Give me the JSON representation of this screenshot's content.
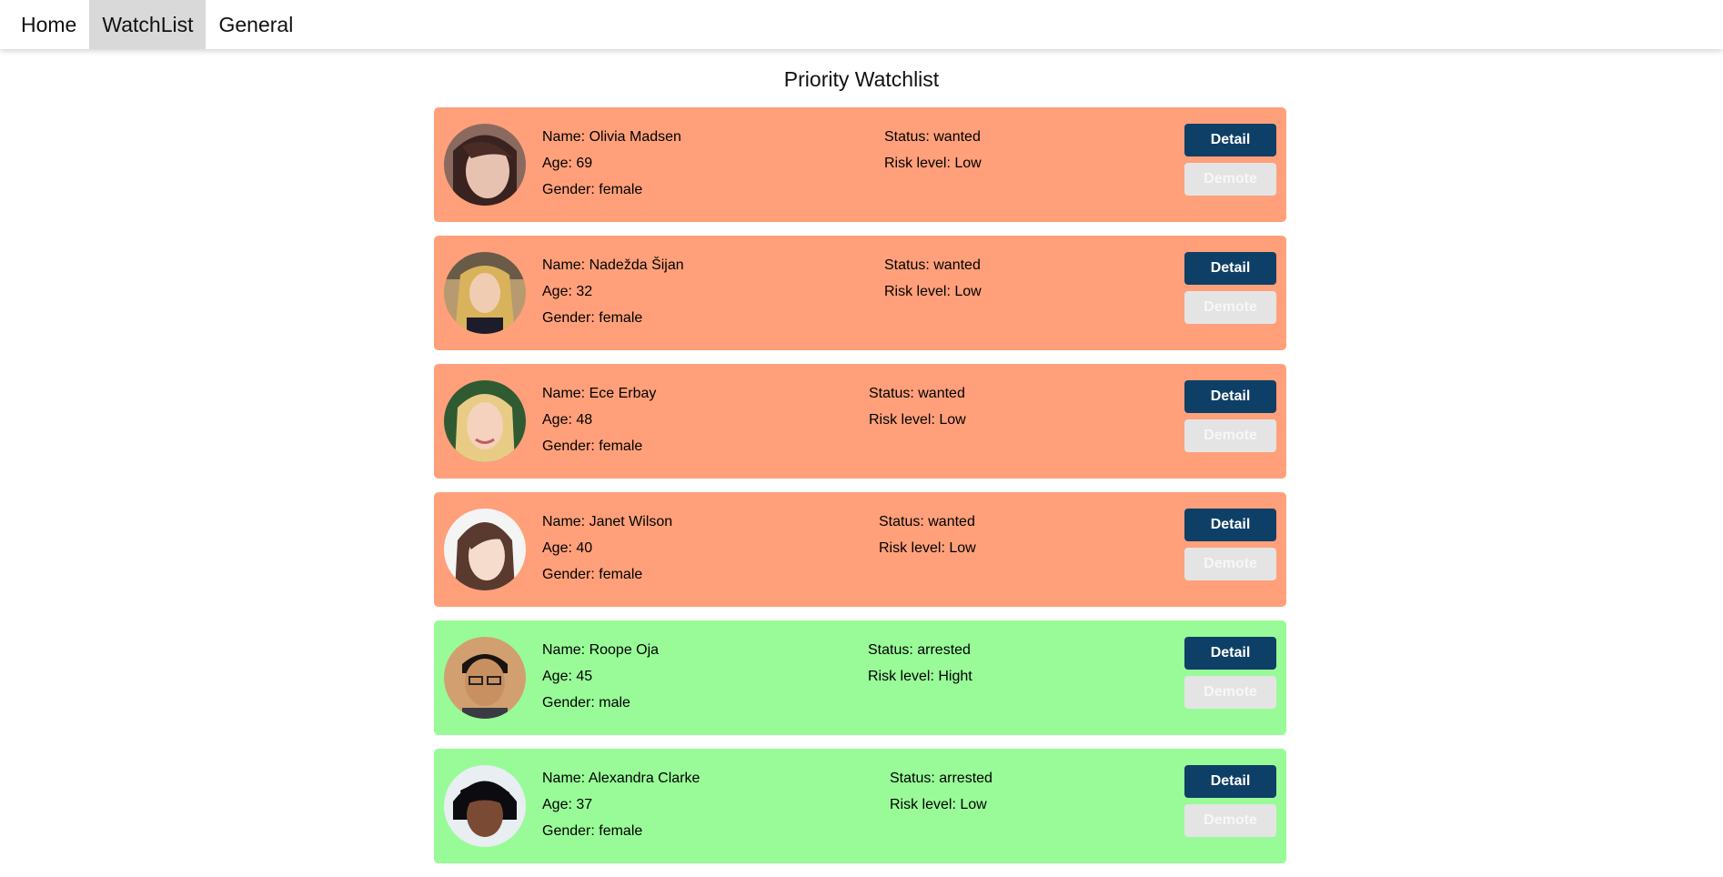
{
  "nav": {
    "items": [
      "Home",
      "WatchList",
      "General"
    ],
    "active": "WatchList"
  },
  "page": {
    "title": "Priority Watchlist"
  },
  "colors": {
    "wanted": "#ffa07a",
    "arrested": "#98fb98",
    "detail_button": "#0e3f66",
    "active_nav": "#d9d9d9"
  },
  "buttons": {
    "detail": "Detail",
    "demote": "Demote"
  },
  "cards": [
    {
      "name": "Name: Olivia Madsen",
      "age": "Age: 69",
      "gender": "Gender: female",
      "status": "Status: wanted",
      "risk": "Risk level: Low",
      "state": "wanted"
    },
    {
      "name": "Name: Nadežda Šijan",
      "age": "Age: 32",
      "gender": "Gender: female",
      "status": "Status: wanted",
      "risk": "Risk level: Low",
      "state": "wanted"
    },
    {
      "name": "Name: Ece Erbay",
      "age": "Age: 48",
      "gender": "Gender: female",
      "status": "Status: wanted",
      "risk": "Risk level: Low",
      "state": "wanted"
    },
    {
      "name": "Name: Janet Wilson",
      "age": "Age: 40",
      "gender": "Gender: female",
      "status": "Status: wanted",
      "risk": "Risk level: Low",
      "state": "wanted"
    },
    {
      "name": "Name: Roope Oja",
      "age": "Age: 45",
      "gender": "Gender: male",
      "status": "Status: arrested",
      "risk": "Risk level: Hight",
      "state": "arrested"
    },
    {
      "name": "Name: Alexandra Clarke",
      "age": "Age: 37",
      "gender": "Gender: female",
      "status": "Status: arrested",
      "risk": "Risk level: Low",
      "state": "arrested"
    }
  ]
}
